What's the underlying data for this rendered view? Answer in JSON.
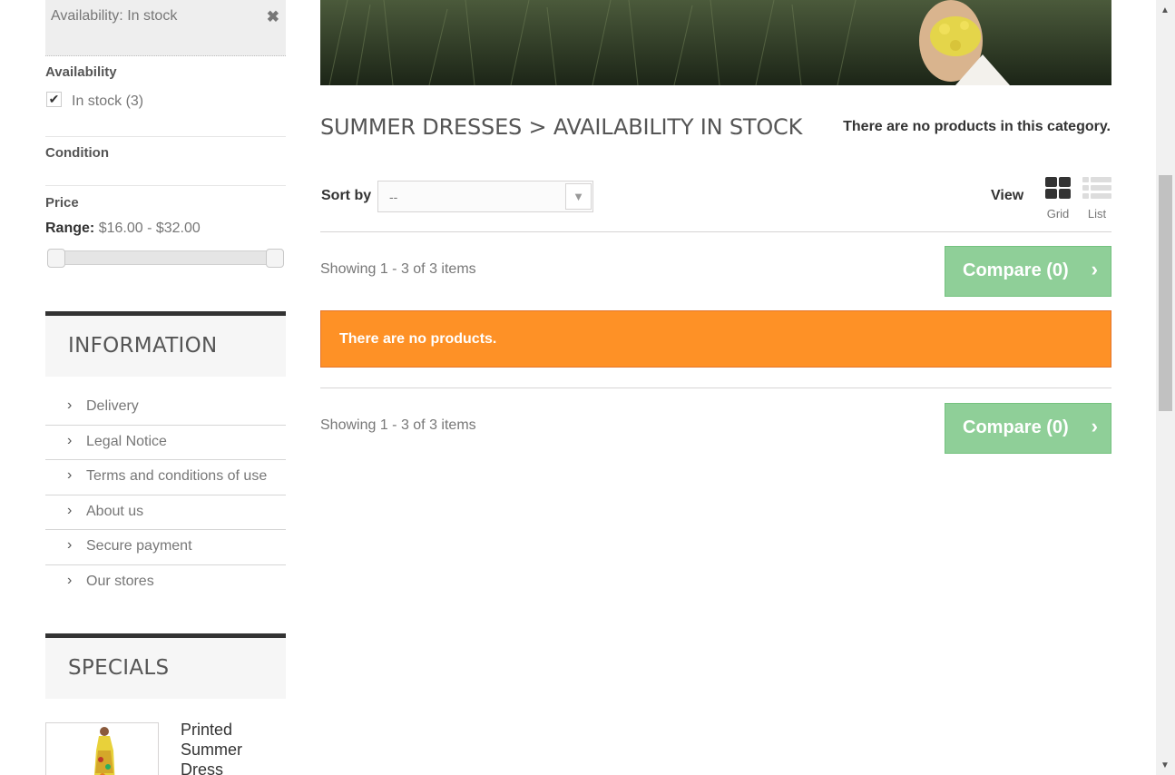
{
  "filters": {
    "active_chip": "Availability: In stock",
    "availability_title": "Availability",
    "in_stock_label": "In stock (3)",
    "in_stock_checked": true,
    "condition_title": "Condition",
    "price_title": "Price",
    "range_label": "Range:",
    "range_value": "$16.00 - $32.00"
  },
  "information": {
    "title": "INFORMATION",
    "items": [
      {
        "label": "Delivery"
      },
      {
        "label": "Legal Notice"
      },
      {
        "label": "Terms and conditions of use"
      },
      {
        "label": "About us"
      },
      {
        "label": "Secure payment"
      },
      {
        "label": "Our stores"
      }
    ]
  },
  "specials": {
    "title": "SPECIALS",
    "product_name": "Printed Summer Dress"
  },
  "category": {
    "heading": "SUMMER DRESSES > AVAILABILITY IN STOCK",
    "note": "There are no products in this category."
  },
  "toolbar": {
    "sort_label": "Sort by",
    "sort_value": "--",
    "view_label": "View",
    "grid_label": "Grid",
    "list_label": "List"
  },
  "results": {
    "showing_top": "Showing 1 - 3 of 3 items",
    "showing_bottom": "Showing 1 - 3 of 3 items",
    "compare_top": "Compare (0)",
    "compare_bottom": "Compare (0)",
    "alert": "There are no products."
  },
  "colors": {
    "alert_bg": "#fe9126",
    "compare_bg": "#8fcf98",
    "block_border": "#333333"
  }
}
